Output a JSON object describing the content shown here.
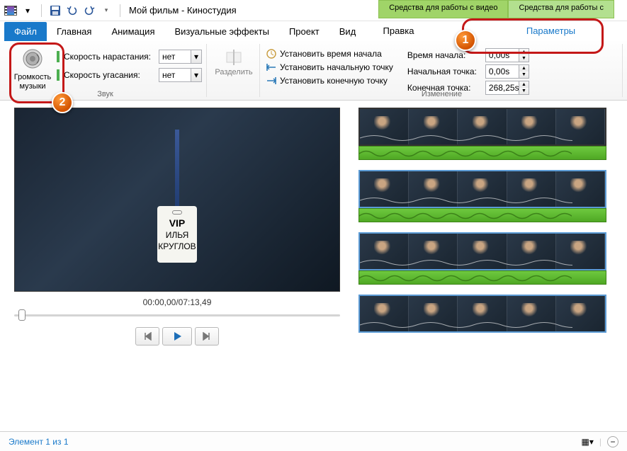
{
  "title": "Мой фильм - Киностудия",
  "context_tabs": {
    "video": "Средства для работы с видео",
    "audio": "Средства для работы с "
  },
  "tabs": {
    "file": "Файл",
    "home": "Главная",
    "animation": "Анимация",
    "video_effects": "Визуальные эффекты",
    "project": "Проект",
    "view": "Вид",
    "edit": "Правка",
    "params": "Параметры"
  },
  "ribbon": {
    "volume_btn": "Громкость\nмузыки",
    "fade_in_label": "Скорость нарастания:",
    "fade_out_label": "Скорость угасания:",
    "fade_in_value": "нет",
    "fade_out_value": "нет",
    "group_sound": "Звук",
    "split": "Разделить",
    "set_start_time": "Установить время начала",
    "set_start_point": "Установить начальную точку",
    "set_end_point": "Установить конечную точку",
    "group_change": "Изменение",
    "start_time_label": "Время начала:",
    "start_point_label": "Начальная точка:",
    "end_point_label": "Конечная точка:",
    "start_time_value": "0,00s",
    "start_point_value": "0,00s",
    "end_point_value": "268,25s"
  },
  "preview": {
    "timecode": "00:00,00/07:13,49",
    "badge_vip": "VIP",
    "badge_name1": "ИЛЬЯ",
    "badge_name2": "КРУГЛОВ"
  },
  "status": {
    "text": "Элемент 1 из 1"
  },
  "callouts": {
    "one": "1",
    "two": "2"
  }
}
